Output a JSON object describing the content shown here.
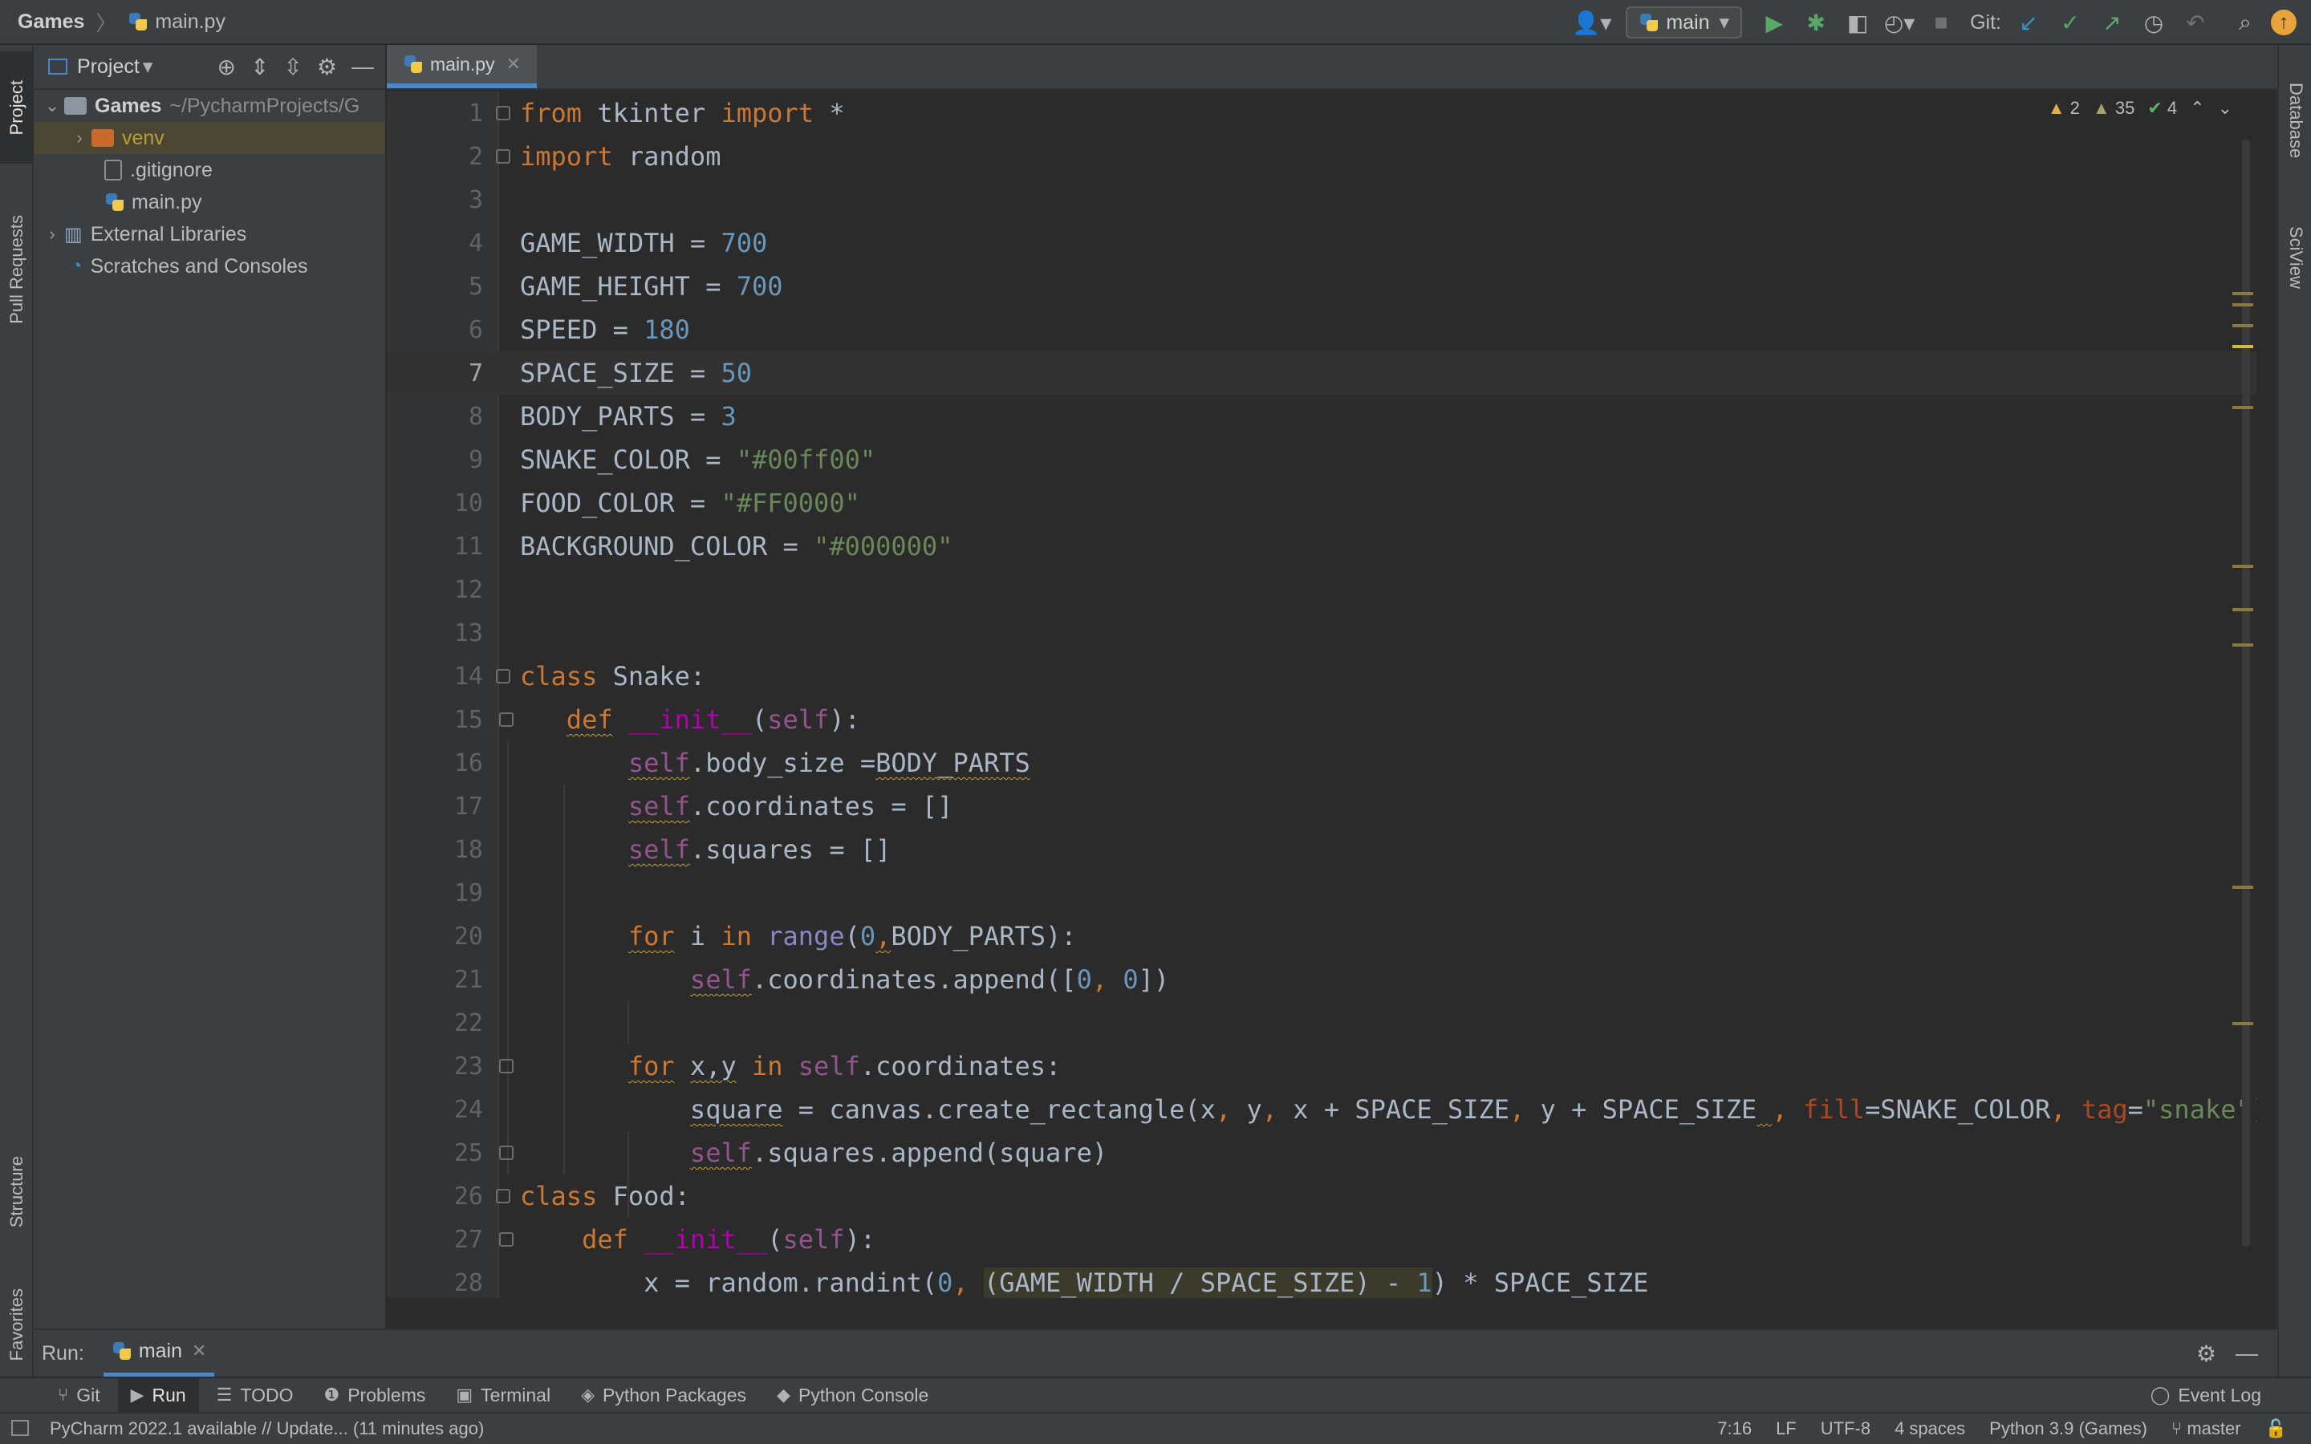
{
  "breadcrumb": {
    "project": "Games",
    "file": "main.py"
  },
  "toolbar": {
    "run_config": "main",
    "git_label": "Git:"
  },
  "left_strip": {
    "project": "Project",
    "pull_requests": "Pull Requests",
    "structure": "Structure",
    "favorites": "Favorites"
  },
  "right_strip": {
    "database": "Database",
    "sciview": "SciView"
  },
  "project_panel": {
    "title": "Project",
    "root": {
      "name": "Games",
      "path": "~/PycharmProjects/G"
    },
    "items": [
      {
        "name": "venv",
        "type": "folder"
      },
      {
        "name": ".gitignore",
        "type": "file"
      },
      {
        "name": "main.py",
        "type": "python"
      },
      {
        "name": "External Libraries",
        "type": "libraries"
      },
      {
        "name": "Scratches and Consoles",
        "type": "scratches"
      }
    ]
  },
  "editor": {
    "tab": "main.py",
    "current_line": 7,
    "inspections": {
      "errors": "2",
      "warnings": "35",
      "ok": "4"
    },
    "lines": [
      "1",
      "2",
      "3",
      "4",
      "5",
      "6",
      "7",
      "8",
      "9",
      "10",
      "11",
      "12",
      "13",
      "14",
      "15",
      "16",
      "17",
      "18",
      "19",
      "20",
      "21",
      "22",
      "23",
      "24",
      "25",
      "26",
      "27",
      "28"
    ]
  },
  "run": {
    "label": "Run:",
    "tab": "main"
  },
  "tool_tabs": [
    "Git",
    "Run",
    "TODO",
    "Problems",
    "Terminal",
    "Python Packages",
    "Python Console"
  ],
  "event_log": "Event Log",
  "status": {
    "message": "PyCharm 2022.1 available // Update... (11 minutes ago)",
    "position": "7:16",
    "line_sep": "LF",
    "encoding": "UTF-8",
    "indent": "4 spaces",
    "interpreter": "Python 3.9 (Games)",
    "branch": "master"
  },
  "colors": {
    "accent": "#4a88c7",
    "keyword": "#cc7832",
    "number": "#6897bb",
    "string": "#6a8759",
    "self": "#94558d"
  }
}
